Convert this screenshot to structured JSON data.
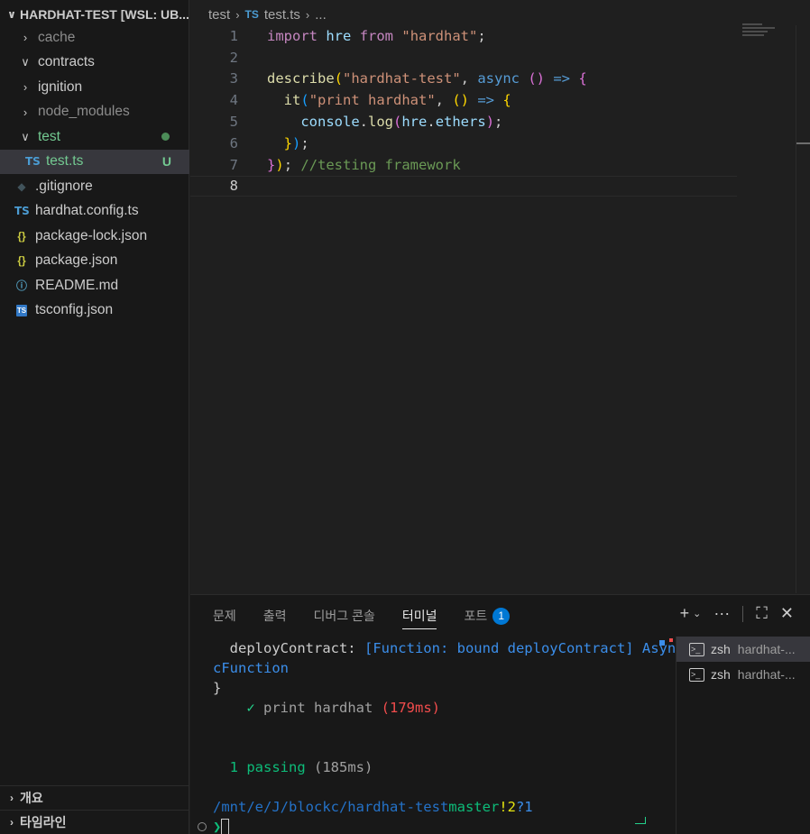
{
  "explorer": {
    "title": "HARDHAT-TEST [WSL: UB...",
    "items": [
      {
        "label": "cache",
        "kind": "folder",
        "expanded": false,
        "depth": 1
      },
      {
        "label": "contracts",
        "kind": "folder",
        "expanded": true,
        "depth": 1
      },
      {
        "label": "ignition",
        "kind": "folder",
        "expanded": false,
        "depth": 1
      },
      {
        "label": "node_modules",
        "kind": "folder",
        "expanded": false,
        "depth": 1
      },
      {
        "label": "test",
        "kind": "folder",
        "expanded": true,
        "depth": 1
      },
      {
        "label": "test.ts",
        "kind": "file",
        "icon": "TS",
        "badge": "U",
        "depth": 2
      },
      {
        "label": ".gitignore",
        "kind": "file",
        "icon": "git-icon",
        "depth": 1
      },
      {
        "label": "hardhat.config.ts",
        "kind": "file",
        "icon": "TS",
        "depth": 1
      },
      {
        "label": "package-lock.json",
        "kind": "file",
        "icon": "{}",
        "depth": 1
      },
      {
        "label": "package.json",
        "kind": "file",
        "icon": "{}",
        "depth": 1
      },
      {
        "label": "README.md",
        "kind": "file",
        "icon": "info-icon",
        "depth": 1
      },
      {
        "label": "tsconfig.json",
        "kind": "file",
        "icon": "TS",
        "depth": 1
      }
    ],
    "sections": [
      "개요",
      "타임라인"
    ]
  },
  "breadcrumb": {
    "folder": "test",
    "file_icon": "TS",
    "file": "test.ts",
    "more": "..."
  },
  "editor": {
    "line_numbers": [
      "1",
      "2",
      "3",
      "4",
      "5",
      "6",
      "7",
      "8"
    ],
    "active_line": "8",
    "code": {
      "l1_import": "import",
      "l1_hre": "hre",
      "l1_from": "from",
      "l1_str": "\"hardhat\"",
      "l1_semi": ";",
      "l3_describe": "describe",
      "l3_str": "\"hardhat-test\"",
      "l3_comma": ", ",
      "l3_async": "async",
      "l3_arrow": " => ",
      "l4_it": "it",
      "l4_str": "\"print hardhat\"",
      "l5_console": "console",
      "l5_log": "log",
      "l5_hre": "hre",
      "l5_ethers": "ethers",
      "l7_comment": "//testing framework"
    }
  },
  "panel": {
    "tabs": [
      "문제",
      "출력",
      "디버그 콘솔",
      "터미널",
      "포트"
    ],
    "active_tab": "터미널",
    "ports_count": "1",
    "actions": {
      "add": "+",
      "dropdown": "⌄",
      "more": "···",
      "maximize": "⛶",
      "close": "✕"
    }
  },
  "terminal": {
    "line1_key": "  deployContract: ",
    "line1_val": "[Function: bound deployContract] Asyn",
    "line2": "cFunction",
    "line3": "}",
    "check": "✓",
    "test_name": " print hardhat ",
    "test_time": "(179ms)",
    "passing": "  1 passing",
    "passing_time": " (185ms)",
    "prompt_path": "/mnt/e/J/blockc/hardhat-test",
    "prompt_branch": "master",
    "prompt_mod": "!2",
    "prompt_untracked": "?1",
    "prompt_symbol": "❯",
    "sessions": [
      {
        "name": "zsh",
        "desc": "hardhat-..."
      },
      {
        "name": "zsh",
        "desc": "hardhat-..."
      }
    ]
  }
}
